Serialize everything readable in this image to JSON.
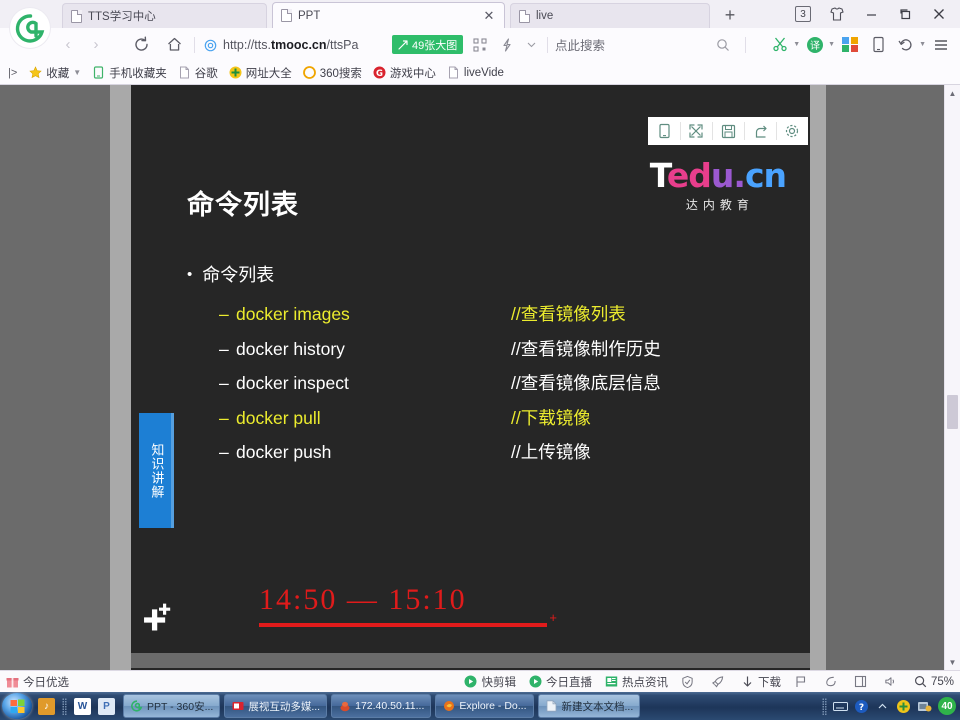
{
  "browser": {
    "tabs": [
      {
        "label": "TTS学习中心",
        "active": false,
        "closable": false
      },
      {
        "label": "PPT",
        "active": true,
        "closable": true
      },
      {
        "label": "live",
        "active": false,
        "closable": false
      }
    ],
    "new_tab_label": "+",
    "tab_count_badge": "3",
    "window_controls": {
      "minimize": "—",
      "maximize": "❐",
      "close": "✕"
    },
    "address": {
      "url_prefix": "http://tts.",
      "url_domain": "tmooc.cn",
      "url_path": "/ttsPa",
      "badge": "49张大图"
    },
    "search_placeholder": "点此搜索",
    "nav": {
      "back": "‹",
      "forward": "›",
      "reload": "reload",
      "home": "home"
    }
  },
  "bookmarks": {
    "overflow": "|>",
    "items": [
      {
        "label": "收藏",
        "icon": "star-icon",
        "has_chevron": true
      },
      {
        "label": "手机收藏夹",
        "icon": "phone-icon",
        "has_chevron": false
      },
      {
        "label": "谷歌",
        "icon": "page-icon",
        "has_chevron": false
      },
      {
        "label": "网址大全",
        "icon": "plus-circle-icon",
        "has_chevron": false
      },
      {
        "label": "360搜索",
        "icon": "circle-icon",
        "has_chevron": false
      },
      {
        "label": "游戏中心",
        "icon": "g-circle-icon",
        "has_chevron": false
      },
      {
        "label": "liveVide",
        "icon": "page-icon",
        "has_chevron": false
      }
    ]
  },
  "slide_toolbar": [
    {
      "name": "mobile-view-icon",
      "glyph": "mobile"
    },
    {
      "name": "fullscreen-icon",
      "glyph": "expand"
    },
    {
      "name": "save-icon",
      "glyph": "save"
    },
    {
      "name": "share-icon",
      "glyph": "share"
    },
    {
      "name": "settings-icon",
      "glyph": "gear"
    }
  ],
  "slide": {
    "logo": {
      "part1": "T",
      "part2": "ed",
      "part3": "u.",
      "part4": "cn",
      "subtitle": "达内教育"
    },
    "title": "命令列表",
    "bullet": {
      "marker": "•",
      "text": "命令列表"
    },
    "side_tab": "知识讲解",
    "commands": [
      {
        "dash": "–",
        "cmd": "docker images",
        "note": "//查看镜像列表",
        "highlight": true
      },
      {
        "dash": "–",
        "cmd": "docker history",
        "note": "//查看镜像制作历史",
        "highlight": false
      },
      {
        "dash": "–",
        "cmd": "docker inspect",
        "note": "//查看镜像底层信息",
        "highlight": false
      },
      {
        "dash": "–",
        "cmd": "docker pull",
        "note": "//下载镜像",
        "highlight": true
      },
      {
        "dash": "–",
        "cmd": "docker push",
        "note": "//上传镜像",
        "highlight": false
      }
    ],
    "time_range": "14:50  —  15:10",
    "colors": {
      "background": "#262626",
      "highlight": "#ecec2e",
      "time_red": "#e01b1b",
      "side_tab_blue": "#1d7fd4"
    }
  },
  "statusbar": {
    "left": {
      "label": "今日优选",
      "icon": "gift-icon"
    },
    "items": [
      {
        "label": "快剪辑",
        "icon": "play-circle-icon"
      },
      {
        "label": "今日直播",
        "icon": "play-circle-icon"
      },
      {
        "label": "热点资讯",
        "icon": "news-icon"
      },
      {
        "label": "",
        "icon": "shield-icon"
      },
      {
        "label": "",
        "icon": "rocket-icon"
      },
      {
        "label": "下载",
        "icon": "download-icon"
      },
      {
        "label": "",
        "icon": "flag-icon"
      },
      {
        "label": "",
        "icon": "cloud-icon"
      },
      {
        "label": "",
        "icon": "window-icon"
      },
      {
        "label": "",
        "icon": "sound-icon"
      },
      {
        "label": "",
        "icon": "zoom-icon"
      }
    ],
    "zoom_level": "75%"
  },
  "taskbar": {
    "start": "start-orb",
    "quick_launch": [
      {
        "name": "media-icon",
        "glyph": "♫"
      },
      {
        "name": "word-icon",
        "glyph": "W"
      },
      {
        "name": "powerpoint-icon",
        "glyph": "P"
      }
    ],
    "tasks": [
      {
        "label": "PPT - 360安...",
        "icon": "browser-icon",
        "active": true
      },
      {
        "label": "展视互动多媒...",
        "icon": "video-icon",
        "active": false
      },
      {
        "label": "172.40.50.11...",
        "icon": "terminal-icon",
        "active": false
      },
      {
        "label": "Explore - Do...",
        "icon": "firefox-icon",
        "active": false
      },
      {
        "label": "新建文本文档...",
        "icon": "notepad-icon",
        "active": true
      }
    ],
    "tray": [
      {
        "name": "show-desktop-icon"
      },
      {
        "name": "keyboard-icon"
      },
      {
        "name": "help-icon"
      },
      {
        "name": "expand-tray-icon"
      },
      {
        "name": "security-icon"
      },
      {
        "name": "network-icon"
      }
    ],
    "tray_badge": "40"
  }
}
